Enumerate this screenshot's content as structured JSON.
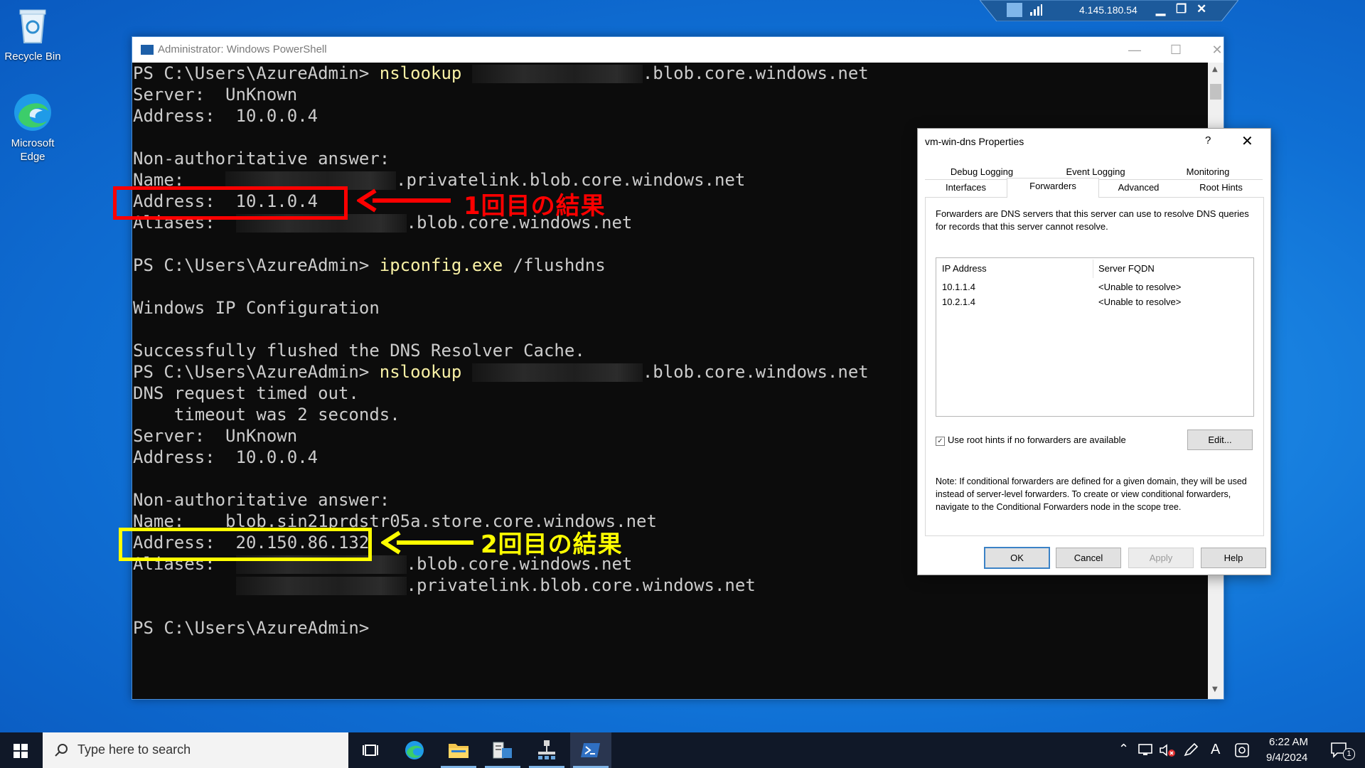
{
  "desktop": {
    "icons": [
      {
        "label": "Recycle Bin"
      },
      {
        "label": "Microsoft Edge"
      }
    ]
  },
  "rdp_bar": {
    "ip": "4.145.180.54"
  },
  "powershell": {
    "title": "Administrator: Windows PowerShell",
    "lines": [
      {
        "parts": [
          {
            "t": "PS C:\\Users\\AzureAdmin> "
          },
          {
            "t": "nslookup",
            "c": "cmd"
          },
          {
            "t": " "
          },
          {
            "redact": true
          },
          {
            "t": ".blob.core.windows.net"
          }
        ]
      },
      {
        "parts": [
          {
            "t": "Server:  UnKnown"
          }
        ]
      },
      {
        "parts": [
          {
            "t": "Address:  10.0.0.4"
          }
        ]
      },
      {
        "parts": []
      },
      {
        "parts": [
          {
            "t": "Non-authoritative answer:"
          }
        ]
      },
      {
        "parts": [
          {
            "t": "Name:    "
          },
          {
            "redact": true
          },
          {
            "t": ".privatelink.blob.core.windows.net"
          }
        ]
      },
      {
        "parts": [
          {
            "t": "Address:  10.1.0.4"
          }
        ]
      },
      {
        "parts": [
          {
            "t": "Aliases:  "
          },
          {
            "redact": true
          },
          {
            "t": ".blob.core.windows.net"
          }
        ]
      },
      {
        "parts": []
      },
      {
        "parts": [
          {
            "t": "PS C:\\Users\\AzureAdmin> "
          },
          {
            "t": "ipconfig.exe",
            "c": "cmd"
          },
          {
            "t": " /flushdns"
          }
        ]
      },
      {
        "parts": []
      },
      {
        "parts": [
          {
            "t": "Windows IP Configuration"
          }
        ]
      },
      {
        "parts": []
      },
      {
        "parts": [
          {
            "t": "Successfully flushed the DNS Resolver Cache."
          }
        ]
      },
      {
        "parts": [
          {
            "t": "PS C:\\Users\\AzureAdmin> "
          },
          {
            "t": "nslookup",
            "c": "cmd"
          },
          {
            "t": " "
          },
          {
            "redact": true
          },
          {
            "t": ".blob.core.windows.net"
          }
        ]
      },
      {
        "parts": [
          {
            "t": "DNS request timed out."
          }
        ]
      },
      {
        "parts": [
          {
            "t": "    timeout was 2 seconds."
          }
        ]
      },
      {
        "parts": [
          {
            "t": "Server:  UnKnown"
          }
        ]
      },
      {
        "parts": [
          {
            "t": "Address:  10.0.0.4"
          }
        ]
      },
      {
        "parts": []
      },
      {
        "parts": [
          {
            "t": "Non-authoritative answer:"
          }
        ]
      },
      {
        "parts": [
          {
            "t": "Name:    blob.sin21prdstr05a.store.core.windows.net"
          }
        ]
      },
      {
        "parts": [
          {
            "t": "Address:  20.150.86.132"
          }
        ]
      },
      {
        "parts": [
          {
            "t": "Aliases:  "
          },
          {
            "redact": true
          },
          {
            "t": ".blob.core.windows.net"
          }
        ]
      },
      {
        "parts": [
          {
            "t": "          "
          },
          {
            "redact": true
          },
          {
            "t": ".privatelink.blob.core.windows.net"
          }
        ]
      },
      {
        "parts": []
      },
      {
        "parts": [
          {
            "t": "PS C:\\Users\\AzureAdmin>"
          }
        ]
      }
    ]
  },
  "annotations": {
    "first": {
      "text": "1回目の結果",
      "color": "#ff0000"
    },
    "second": {
      "text": "2回目の結果",
      "color": "#ffff00"
    }
  },
  "dialog": {
    "title": "vm-win-dns Properties",
    "help": "?",
    "close": "✕",
    "tabs_row1": [
      "Debug Logging",
      "Event Logging",
      "Monitoring"
    ],
    "tabs_row2": [
      "Interfaces",
      "Forwarders",
      "Advanced",
      "Root Hints"
    ],
    "active_tab": "Forwarders",
    "description": "Forwarders are DNS servers that this server can use to resolve DNS queries for records that this server cannot resolve.",
    "columns": [
      "IP Address",
      "Server FQDN"
    ],
    "rows": [
      {
        "ip": "10.1.1.4",
        "fqdn": "<Unable to resolve>"
      },
      {
        "ip": "10.2.1.4",
        "fqdn": "<Unable to resolve>"
      }
    ],
    "checkbox_label": "Use root hints if no forwarders are available",
    "checkbox_checked": true,
    "edit_button": "Edit...",
    "note": "Note: If conditional forwarders are defined for a given domain, they will be used instead of server-level forwarders.  To create or view conditional forwarders, navigate to the Conditional Forwarders node in the scope tree.",
    "buttons": {
      "ok": "OK",
      "cancel": "Cancel",
      "apply": "Apply",
      "help": "Help"
    }
  },
  "taskbar": {
    "search_placeholder": "Type here to search",
    "apps": [
      "task-view",
      "edge",
      "file-explorer",
      "server-manager",
      "network-tool",
      "powershell"
    ],
    "tray_ime": "A",
    "time": "6:22 AM",
    "date": "9/4/2024",
    "notification_count": "1"
  }
}
